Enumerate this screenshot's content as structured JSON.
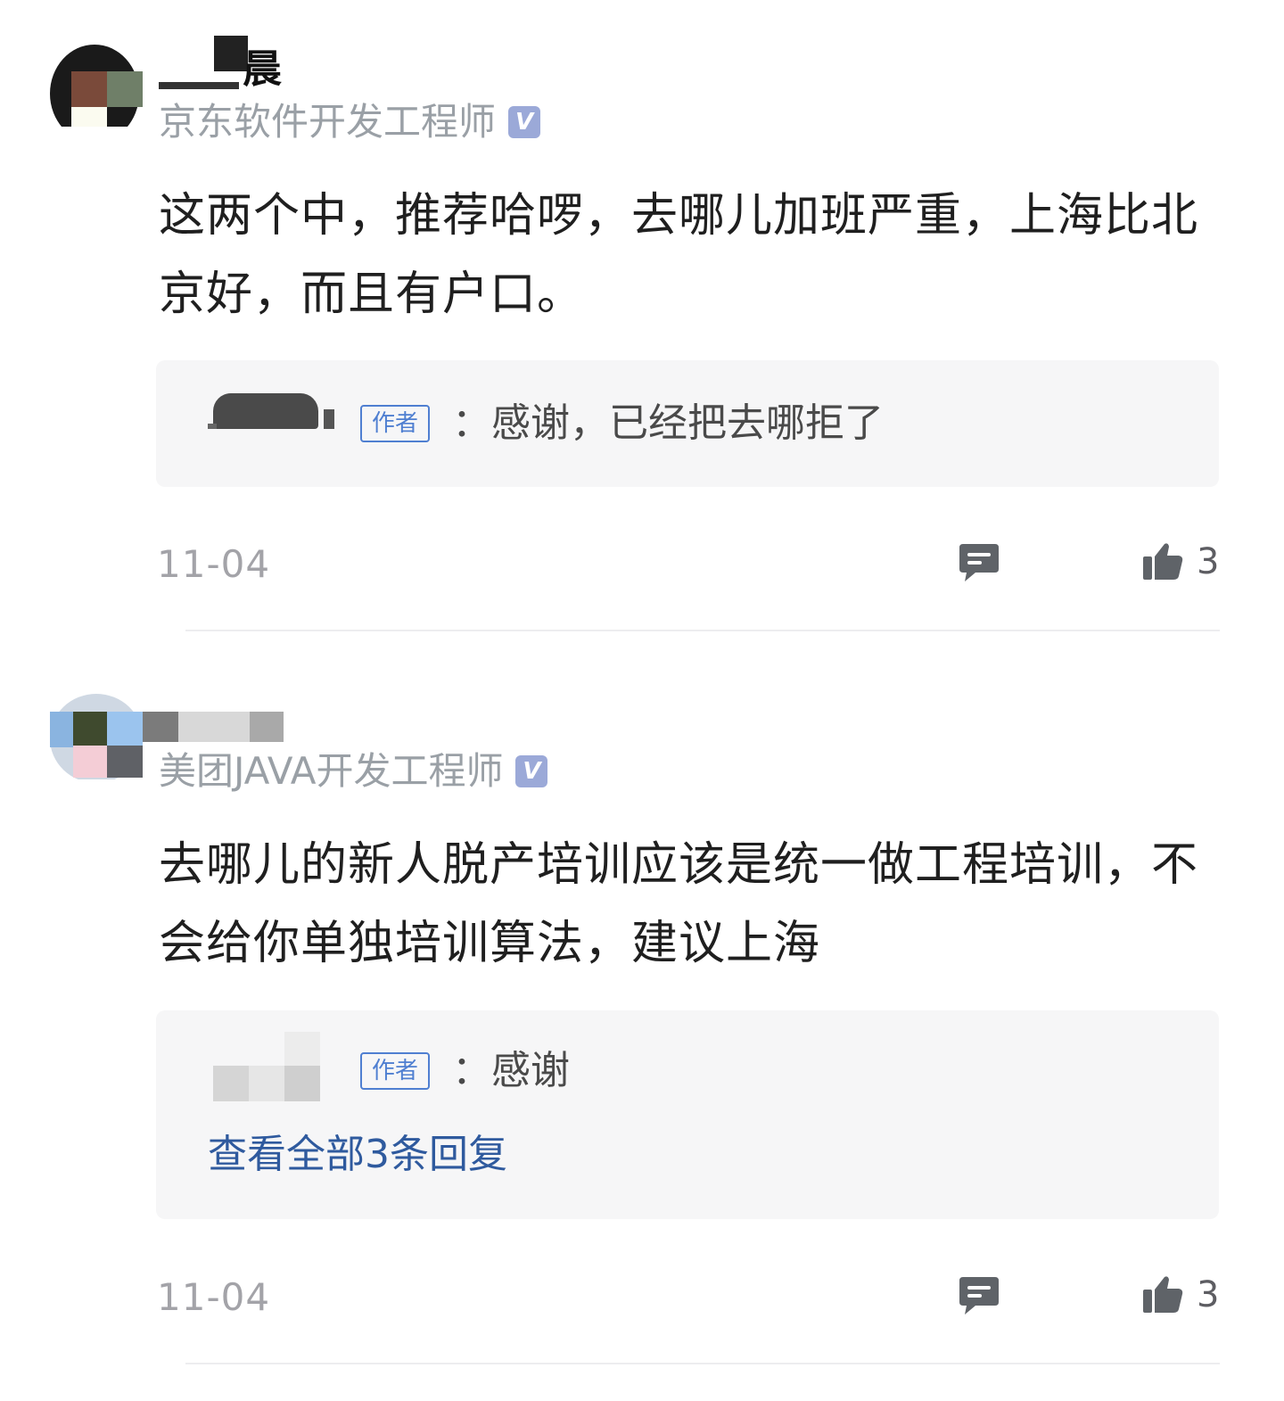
{
  "comments": [
    {
      "author_suffix": "晨",
      "subtitle": "京东软件开发工程师",
      "verified_badge": "V",
      "body": "这两个中，推荐哈啰，去哪儿加班严重，上海比北京好，而且有户口。",
      "reply": {
        "author_tag": "作者",
        "text": "：感谢，已经把去哪拒了"
      },
      "date": "11-04",
      "reply_icon": "comment-bubble-icon",
      "like_icon": "thumbs-up-icon",
      "like_count": "3"
    },
    {
      "subtitle": "美团JAVA开发工程师",
      "verified_badge": "V",
      "body": "去哪儿的新人脱产培训应该是统一做工程培训，不会给你单独培训算法，建议上海",
      "reply": {
        "author_tag": "作者",
        "text": "：感谢"
      },
      "view_all": "查看全部3条回复",
      "date": "11-04",
      "reply_icon": "comment-bubble-icon",
      "like_icon": "thumbs-up-icon",
      "like_count": "3"
    }
  ],
  "colors": {
    "subtitle_gray": "#9aa0a6",
    "link_blue": "#2f5a9e",
    "author_tag_blue": "#4f7fd1",
    "verified_badge": "#9ba9d8",
    "reply_bg": "#f6f6f7"
  }
}
